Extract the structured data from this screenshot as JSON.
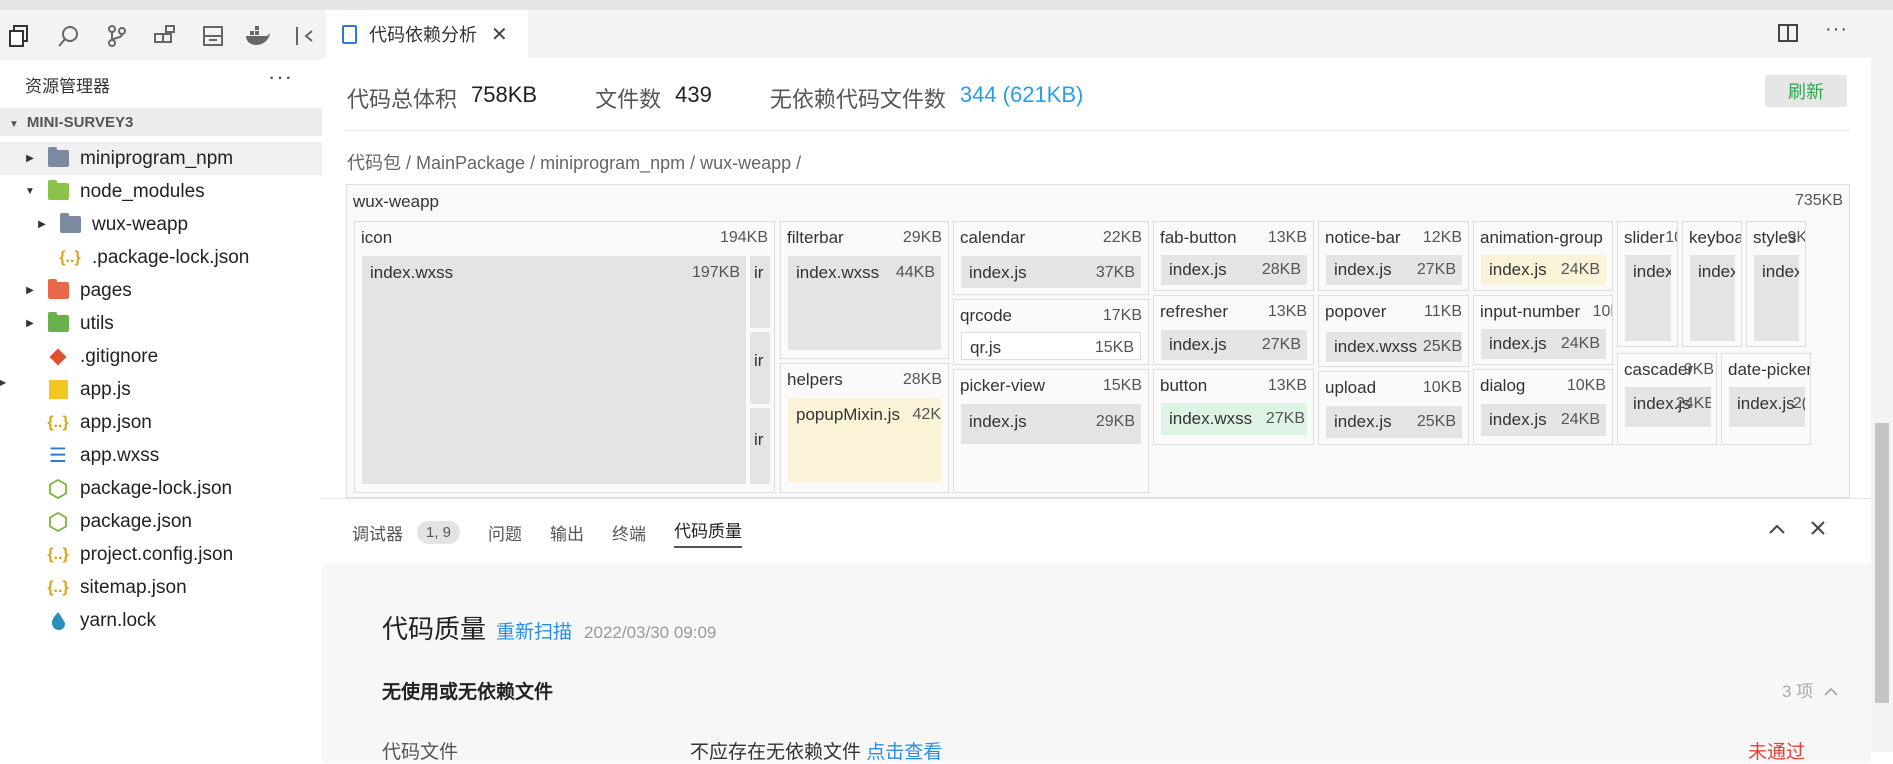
{
  "sidebar": {
    "title": "资源管理器",
    "more": "···",
    "project": "MINI-SURVEY3",
    "items": [
      {
        "label": "miniprogram_npm",
        "icon": "folder-icon"
      },
      {
        "label": "node_modules",
        "icon": "folder-node-icon"
      },
      {
        "label": "wux-weapp",
        "icon": "folder-icon"
      },
      {
        "label": ".package-lock.json",
        "icon": "json-icon"
      },
      {
        "label": "pages",
        "icon": "folder-pages-icon"
      },
      {
        "label": "utils",
        "icon": "folder-utils-icon"
      },
      {
        "label": ".gitignore",
        "icon": "git-icon"
      },
      {
        "label": "app.js",
        "icon": "js-icon"
      },
      {
        "label": "app.json",
        "icon": "json-icon"
      },
      {
        "label": "app.wxss",
        "icon": "css-icon"
      },
      {
        "label": "package-lock.json",
        "icon": "npm-icon"
      },
      {
        "label": "package.json",
        "icon": "npm-icon"
      },
      {
        "label": "project.config.json",
        "icon": "json-icon"
      },
      {
        "label": "sitemap.json",
        "icon": "json-icon"
      },
      {
        "label": "yarn.lock",
        "icon": "yarn-icon"
      }
    ]
  },
  "tab": {
    "label": "代码依赖分析",
    "close": "✕"
  },
  "stats": {
    "total_label": "代码总体积",
    "total_value": "758KB",
    "files_label": "文件数",
    "files_value": "439",
    "nodep_label": "无依赖代码文件数",
    "nodep_value": "344 (621KB)"
  },
  "refresh_label": "刷新",
  "breadcrumb": "代码包 / MainPackage / miniprogram_npm / wux-weapp /",
  "treemap": {
    "title": "wux-weapp",
    "size": "735KB",
    "icon": {
      "label": "icon",
      "size": "194KB",
      "leaf": "index.wxss",
      "leaf_size": "197KB",
      "sub": [
        "ir",
        "ir",
        "ir"
      ]
    },
    "filterbar": {
      "label": "filterbar",
      "size": "29KB",
      "leaf": "index.wxss",
      "leaf_size": "44KB"
    },
    "helpers": {
      "label": "helpers",
      "size": "28KB",
      "leaf": "popupMixin.js",
      "leaf_size": "42K"
    },
    "calendar": {
      "label": "calendar",
      "size": "22KB",
      "leaf": "index.js",
      "leaf_size": "37KB"
    },
    "qrcode": {
      "label": "qrcode",
      "size": "17KB",
      "leaf": "qr.js",
      "leaf_size": "15KB"
    },
    "picker_view": {
      "label": "picker-view",
      "size": "15KB",
      "leaf": "index.js",
      "leaf_size": "29KB"
    },
    "fab_button": {
      "label": "fab-button",
      "size": "13KB",
      "leaf": "index.js",
      "leaf_size": "28KB"
    },
    "refresher": {
      "label": "refresher",
      "size": "13KB",
      "leaf": "index.js",
      "leaf_size": "27KB"
    },
    "button": {
      "label": "button",
      "size": "13KB",
      "leaf": "index.wxss",
      "leaf_size": "27KB"
    },
    "notice_bar": {
      "label": "notice-bar",
      "size": "12KB",
      "leaf": "index.js",
      "leaf_size": "27KB"
    },
    "popover": {
      "label": "popover",
      "size": "11KB",
      "leaf": "index.wxss",
      "leaf_size": "25KB"
    },
    "upload": {
      "label": "upload",
      "size": "10KB",
      "leaf": "index.js",
      "leaf_size": "25KB"
    },
    "animation_group": {
      "label": "animation-group",
      "leaf": "index.js",
      "leaf_size": "24KB"
    },
    "input_number": {
      "label": "input-number",
      "size": "10l",
      "leaf": "index.js",
      "leaf_size": "24KB"
    },
    "dialog": {
      "label": "dialog",
      "size": "10KB",
      "leaf": "index.js",
      "leaf_size": "24KB"
    },
    "slider": {
      "label": "slider",
      "size": "10",
      "leaf": "index."
    },
    "keyboard": {
      "label": "keyboar",
      "leaf": "index."
    },
    "styles": {
      "label": "styles",
      "size": "9K",
      "leaf": "index."
    },
    "cascader": {
      "label": "cascader",
      "size": "9KB",
      "leaf": "index.js",
      "leaf_size": "24KE"
    },
    "date_picker": {
      "label": "date-picker",
      "leaf": "index.js",
      "leaf_size": "2("
    }
  },
  "panel": {
    "tabs": [
      "调试器",
      "问题",
      "输出",
      "终端",
      "代码质量"
    ],
    "badge": "1, 9",
    "quality_title": "代码质量",
    "rescan": "重新扫描",
    "date": "2022/03/30 09:09",
    "section": "无使用或无依赖文件",
    "count": "3 项",
    "row_label": "代码文件",
    "row_desc": "不应存在无依赖文件",
    "row_link": "点击查看",
    "row_status": "未通过"
  },
  "colors": {
    "accent": "#2a8ee6",
    "refresh": "#2aa84a",
    "fail": "#e0443a",
    "js_leaf": "#fbf3d8",
    "wxss_leaf": "#ddf3e4"
  }
}
